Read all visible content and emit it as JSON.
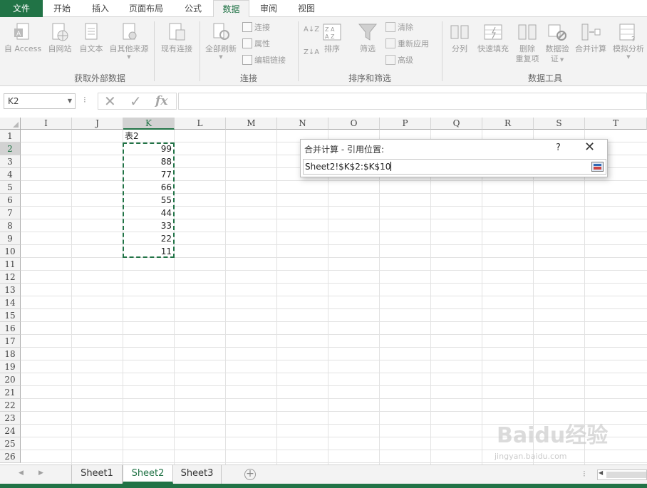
{
  "tabs": [
    "文件",
    "开始",
    "插入",
    "页面布局",
    "公式",
    "数据",
    "审阅",
    "视图"
  ],
  "active_tab": "数据",
  "ribbon": {
    "get_external": {
      "label": "获取外部数据",
      "buttons": [
        "自 Access",
        "自网站",
        "自文本",
        "自其他来源",
        "现有连接"
      ]
    },
    "connections": {
      "label": "连接",
      "refresh_all": "全部刷新",
      "small": [
        "连接",
        "属性",
        "编辑链接"
      ]
    },
    "sort_filter": {
      "label": "排序和筛选",
      "sort": "排序",
      "filter": "筛选",
      "small": [
        "清除",
        "重新应用",
        "高级"
      ]
    },
    "data_tools": {
      "label": "数据工具",
      "text_to_columns": "分列",
      "flash_fill": "快速填充",
      "remove_dup_1": "删除",
      "remove_dup_2": "重复项",
      "validation_1": "数据验",
      "validation_2": "证",
      "consolidate": "合并计算",
      "what_if": "模拟分析"
    }
  },
  "formula_bar": {
    "name_box": "K2",
    "fx": "fx",
    "value": ""
  },
  "columns": [
    "I",
    "J",
    "K",
    "L",
    "M",
    "N",
    "O",
    "P",
    "Q",
    "R",
    "S",
    "T"
  ],
  "rows": [
    "1",
    "2",
    "3",
    "4",
    "5",
    "6",
    "7",
    "8",
    "9",
    "10",
    "11",
    "12",
    "13",
    "14",
    "15",
    "16",
    "17",
    "18",
    "19",
    "20",
    "21",
    "22",
    "23",
    "24",
    "25",
    "26"
  ],
  "cells": {
    "header": "表2",
    "values": [
      "99",
      "88",
      "77",
      "66",
      "55",
      "44",
      "33",
      "22",
      "11"
    ]
  },
  "dialog": {
    "title": "合并计算 - 引用位置:",
    "help": "?",
    "reference": "Sheet2!$K$2:$K$10"
  },
  "sheets": [
    "Sheet1",
    "Sheet2",
    "Sheet3"
  ],
  "active_sheet": "Sheet2",
  "watermark": {
    "brand": "Baidu经验",
    "url": "jingyan.baidu.com"
  },
  "colors": {
    "accent": "#217346",
    "ribbon_bg": "#f3f3f3"
  }
}
